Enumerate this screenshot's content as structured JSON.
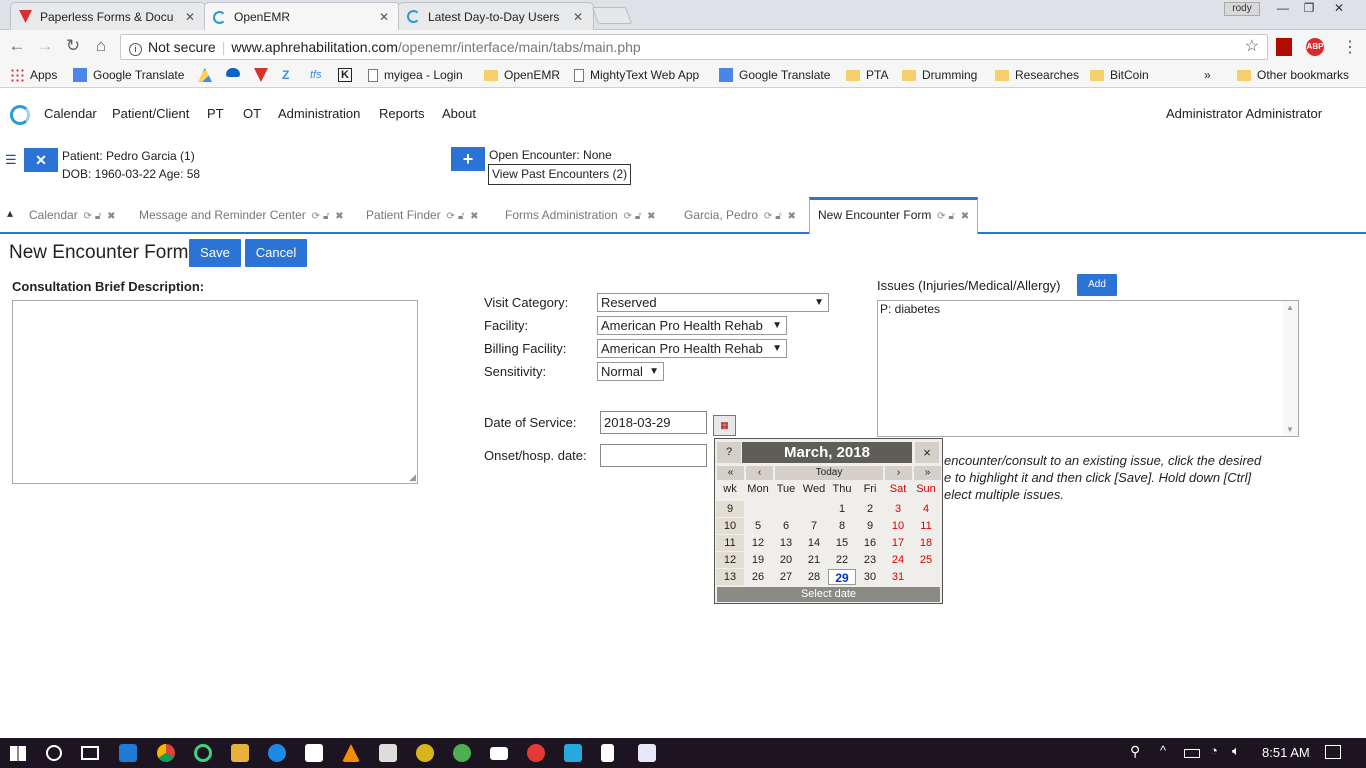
{
  "browser": {
    "tabs": [
      {
        "title": "Paperless Forms & Docu",
        "color": "#d7322e"
      },
      {
        "title": "OpenEMR",
        "color": "#2b9ad6"
      },
      {
        "title": "Latest Day-to-Day Users",
        "color": "#2b9ad6"
      }
    ],
    "user_badge": "rody",
    "not_secure": "Not secure",
    "url_domain": "www.aphrehabilitation.com",
    "url_path": "/openemr/interface/main/tabs/main.php",
    "bookmarks": [
      {
        "label": "Apps",
        "icon": "apps-grid-icon"
      },
      {
        "label": "Google Translate",
        "icon": "translate-icon"
      },
      {
        "label": "",
        "icon": "drive-icon"
      },
      {
        "label": "",
        "icon": "onedrive-icon"
      },
      {
        "label": "",
        "icon": "pdf-icon"
      },
      {
        "label": "",
        "icon": "z-icon"
      },
      {
        "label": "",
        "icon": "tfs-icon"
      },
      {
        "label": "",
        "icon": "k-icon"
      },
      {
        "label": "myigea - Login",
        "icon": "page-icon"
      },
      {
        "label": "OpenEMR",
        "icon": "folder-icon"
      },
      {
        "label": "MightyText Web App",
        "icon": "page-icon"
      },
      {
        "label": "Google Translate",
        "icon": "translate-icon"
      },
      {
        "label": "PTA",
        "icon": "folder-icon"
      },
      {
        "label": "Drumming",
        "icon": "folder-icon"
      },
      {
        "label": "Researches",
        "icon": "folder-icon"
      },
      {
        "label": "BitCoin",
        "icon": "folder-icon"
      }
    ],
    "more": "»",
    "other_bookmarks": "Other bookmarks"
  },
  "menu": {
    "items": [
      "Calendar",
      "Patient/Client",
      "PT",
      "OT",
      "Administration",
      "Reports",
      "About"
    ],
    "user": "Administrator Administrator"
  },
  "patient": {
    "name_line": "Patient: Pedro Garcia (1)",
    "dob_line": "DOB: 1960-03-22 Age: 58",
    "encounter": "Open Encounter: None",
    "past_encounters": "View Past Encounters (2)"
  },
  "tabs": [
    {
      "label": "Calendar"
    },
    {
      "label": "Message and Reminder Center"
    },
    {
      "label": "Patient Finder"
    },
    {
      "label": "Forms Administration"
    },
    {
      "label": "Garcia, Pedro"
    },
    {
      "label": "New Encounter Form"
    }
  ],
  "form": {
    "title": "New Encounter Form",
    "save": "Save",
    "cancel": "Cancel",
    "consult_label": "Consultation Brief Description:",
    "visit_category_label": "Visit Category:",
    "visit_category_value": "Reserved",
    "facility_label": "Facility:",
    "facility_value": "American Pro Health Rehab",
    "billing_label": "Billing Facility:",
    "billing_value": "American Pro Health Rehab",
    "sensitivity_label": "Sensitivity:",
    "sensitivity_value": "Normal",
    "dos_label": "Date of Service:",
    "dos_value": "2018-03-29",
    "onset_label": "Onset/hosp. date:",
    "onset_value": "",
    "issues_label": "Issues (Injuries/Medical/Allergy)",
    "add": "Add",
    "issue_item": "P: diabetes",
    "help_line1": "encounter/consult to an existing issue, click the desired",
    "help_line2": "e to highlight it and then click [Save]. Hold down [Ctrl]",
    "help_line3": "elect multiple issues."
  },
  "calendar": {
    "title": "March, 2018",
    "help": "?",
    "close": "×",
    "prev_year": "«",
    "prev_month": "‹",
    "today": "Today",
    "next_month": "›",
    "next_year": "»",
    "headers": [
      "wk",
      "Mon",
      "Tue",
      "Wed",
      "Thu",
      "Fri",
      "Sat",
      "Sun"
    ],
    "weeks": [
      [
        "9",
        "",
        "",
        "",
        "1",
        "2",
        "3",
        "4"
      ],
      [
        "10",
        "5",
        "6",
        "7",
        "8",
        "9",
        "10",
        "11"
      ],
      [
        "11",
        "12",
        "13",
        "14",
        "15",
        "16",
        "17",
        "18"
      ],
      [
        "12",
        "19",
        "20",
        "21",
        "22",
        "23",
        "24",
        "25"
      ],
      [
        "13",
        "26",
        "27",
        "28",
        "29",
        "30",
        "31",
        ""
      ]
    ],
    "selected": "29",
    "footer": "Select date"
  },
  "taskbar": {
    "time": "8:51 AM"
  }
}
